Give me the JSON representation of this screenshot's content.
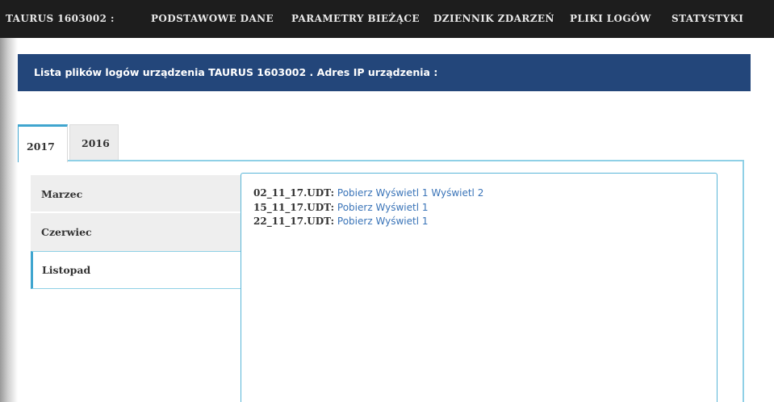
{
  "nav": {
    "items": [
      "TAURUS 1603002 :",
      "PODSTAWOWE DANE",
      "PARAMETRY BIEŻĄCE",
      "DZIENNIK ZDARZEŃ",
      "PLIKI LOGÓW",
      "STATYSTYKI"
    ]
  },
  "banner": {
    "title": "Lista plików logów urządzenia TAURUS 1603002 . Adres IP urządzenia :"
  },
  "tabs": [
    {
      "label": "2017",
      "active": true
    },
    {
      "label": "2016",
      "active": false
    }
  ],
  "months": [
    {
      "label": "Marzec",
      "active": false
    },
    {
      "label": "Czerwiec",
      "active": false
    },
    {
      "label": "Listopad",
      "active": true
    }
  ],
  "files": [
    {
      "name": "02_11_17.UDT:",
      "links": [
        "Pobierz",
        "Wyświetl 1",
        "Wyświetl 2"
      ]
    },
    {
      "name": "15_11_17.UDT:",
      "links": [
        "Pobierz",
        "Wyświetl 1"
      ]
    },
    {
      "name": "22_11_17.UDT:",
      "links": [
        "Pobierz",
        "Wyświetl 1"
      ]
    }
  ],
  "colors": {
    "nav_bg": "#1d1d1d",
    "banner_bg": "#23467a",
    "accent": "#3fa5cf",
    "link": "#3a74b8"
  }
}
